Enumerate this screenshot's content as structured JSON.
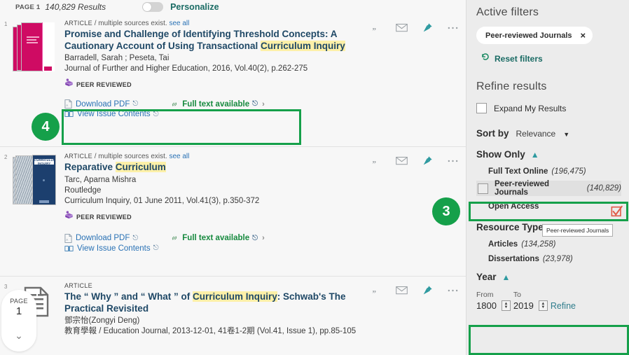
{
  "topbar": {
    "page_label": "PAGE 1",
    "results_count": "140,829 Results",
    "personalize_label": "Personalize",
    "personalize_state": "off"
  },
  "results": [
    {
      "index": "1",
      "kicker_type": "ARTICLE",
      "kicker_sep": "/ multiple sources exist.",
      "kicker_link": "see all",
      "title_pre": "Promise and Challenge of Identifying Threshold Concepts: A Cautionary Account of Using Transactional ",
      "title_highlight": "Curriculum Inquiry",
      "title_post": "",
      "authors": "Barradell, Sarah ; Peseta, Tai",
      "publisher": "",
      "source": "Journal of Further and Higher Education, 2016, Vol.40(2), p.262-275",
      "peer_reviewed": "PEER REVIEWED",
      "download_label": "Download PDF",
      "issue_label": "View Issue Contents",
      "fulltext_label": "Full text available",
      "cover": "pink-journal-stack"
    },
    {
      "index": "2",
      "kicker_type": "ARTICLE",
      "kicker_sep": "/ multiple sources exist.",
      "kicker_link": "see all",
      "title_pre": "Reparative ",
      "title_highlight": "Curriculum",
      "title_post": "",
      "authors": "Tarc, Aparna Mishra",
      "publisher": "Routledge",
      "source": "Curriculum Inquiry, 01 June 2011, Vol.41(3), p.350-372",
      "peer_reviewed": "PEER REVIEWED",
      "download_label": "Download PDF",
      "issue_label": "View Issue Contents",
      "fulltext_label": "Full text available",
      "cover": "blue-curriculum-inquiry"
    },
    {
      "index": "3",
      "kicker_type": "ARTICLE",
      "kicker_sep": "",
      "kicker_link": "",
      "title_pre": "The “ Why ” and “ What ” of ",
      "title_highlight": "Curriculum Inquiry",
      "title_post": ": Schwab's The Practical Revisited",
      "authors": "鄧宗怡(Zongyi Deng)",
      "publisher": "",
      "source": "教育學報 / Education Journal, 2013-12-01, 41卷1-2期 (Vol.41, Issue 1), pp.85-105",
      "peer_reviewed": "",
      "download_label": "",
      "issue_label": "",
      "fulltext_label": "",
      "cover": "document-icon"
    }
  ],
  "result_actions": {
    "citation": "citation-icon",
    "email": "email-icon",
    "pin": "pin-icon",
    "more": "more-options-icon"
  },
  "page_pill": {
    "word": "PAGE",
    "number": "1",
    "chevron": "chevron-down-icon"
  },
  "panel": {
    "active_filters_title": "Active filters",
    "active_chip": "Peer-reviewed Journals",
    "active_chip_close": "×",
    "reset_label": "Reset filters",
    "refine_title": "Refine results",
    "expand_label": "Expand My Results",
    "sort_by_label": "Sort by",
    "sort_by_value": "Relevance",
    "show_only_title": "Show Only",
    "show_only_facets": [
      {
        "label": "Full Text Online",
        "count": "(196,475)"
      },
      {
        "label": "Peer-reviewed Journals",
        "count": "(140,829)"
      },
      {
        "label": "Open Access",
        "count": ""
      }
    ],
    "tooltip_text": "Peer-reviewed Journals",
    "resource_type_title": "Resource Type",
    "resource_type_facets": [
      {
        "label": "Articles",
        "count": "(134,258)"
      },
      {
        "label": "Dissertations",
        "count": "(23,978)"
      }
    ],
    "year_title": "Year",
    "year_from_label": "From",
    "year_from_value": "1800",
    "year_to_label": "To",
    "year_to_value": "2019",
    "refine_button": "Refine"
  },
  "annotations": {
    "badge_4": "4",
    "badge_3": "3",
    "accent_green": "#15a04a",
    "teal": "#1a6b64",
    "link_blue": "#2a72b5",
    "highlight_yellow": "#fdf0a8"
  }
}
